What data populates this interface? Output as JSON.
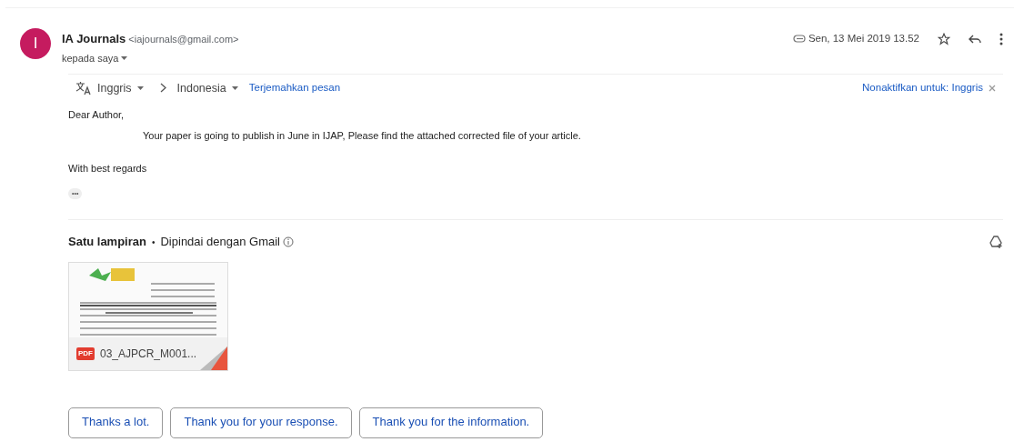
{
  "sender": {
    "initial": "I",
    "name": "IA Journals",
    "email": "<iajournals@gmail.com>",
    "recipient": "kepada saya"
  },
  "header": {
    "date": "Sen, 13 Mei 2019 13.52",
    "starred": false
  },
  "translate": {
    "from": "Inggris",
    "to": "Indonesia",
    "action": "Terjemahkan pesan",
    "disable": "Nonaktifkan untuk: Inggris"
  },
  "body": {
    "greeting": "Dear Author,",
    "message": "Your paper is going to publish in June in IJAP, Please find the attached corrected file of your article.",
    "closing": "With best regards",
    "more": "•••"
  },
  "attachments": {
    "count_label": "Satu lampiran",
    "separator": "•",
    "scan_note": "Dipindai dengan Gmail",
    "files": [
      {
        "type": "PDF",
        "name": "03_AJPCR_M001..."
      }
    ]
  },
  "smart_replies": [
    "Thanks a lot.",
    "Thank you for your response.",
    "Thank you for the information."
  ]
}
